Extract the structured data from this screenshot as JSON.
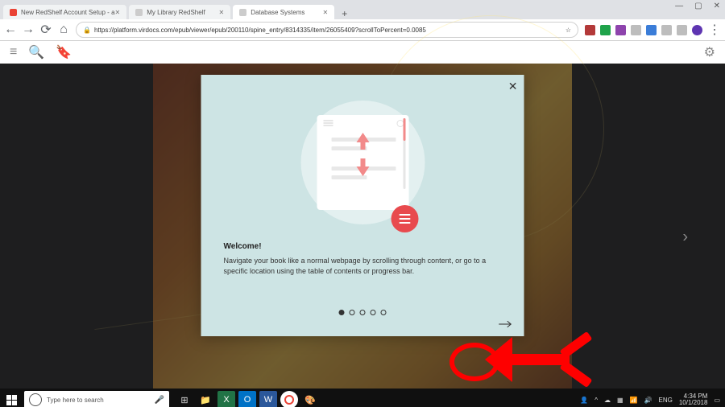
{
  "browser": {
    "tabs": [
      {
        "label": "New RedShelf Account Setup - a",
        "active": false,
        "favicon": "#ea4335"
      },
      {
        "label": "My Library RedShelf",
        "active": false,
        "favicon": "#888"
      },
      {
        "label": "Database Systems",
        "active": true,
        "favicon": "#888"
      }
    ],
    "url": "https://platform.virdocs.com/epub/viewer/epub/200110/spine_entry/8314335/item/26055409?scrollToPercent=0.0085",
    "window_controls": {
      "min": "—",
      "max": "▢",
      "close": "✕"
    },
    "nav": {
      "back": "←",
      "fwd": "→",
      "reload": "⟳",
      "home": "⌂",
      "lock": "🔒",
      "star": "☆",
      "menu": "⋮"
    },
    "extensions": [
      {
        "color": "#b33939"
      },
      {
        "color": "#1fa34a"
      },
      {
        "color": "#8e44ad"
      },
      {
        "color": "#bdbdbd"
      },
      {
        "color": "#3b7dd8"
      },
      {
        "color": "#bdbdbd"
      },
      {
        "color": "#bdbdbd"
      },
      {
        "color": "#5e35b1"
      }
    ]
  },
  "modal": {
    "title": "Welcome!",
    "body": "Navigate your book like a normal webpage by scrolling through content, or go to a specific location using the table of contents or progress bar.",
    "dots_total": 5,
    "dot_active": 0
  },
  "taskbar": {
    "search_placeholder": "Type here to search",
    "apps": [
      {
        "bg": "#1f1f1f",
        "glyph": "⊞",
        "color": "#fff"
      },
      {
        "bg": "#d09b2a",
        "glyph": "📁"
      },
      {
        "bg": "#217346",
        "glyph": "X",
        "color": "#fff"
      },
      {
        "bg": "#2b579a",
        "glyph": "O",
        "color": "#fff"
      },
      {
        "bg": "#2b579a",
        "glyph": "W",
        "color": "#fff"
      },
      {
        "bg": "#fff",
        "glyph": "◉",
        "color": "#ea4335"
      },
      {
        "bg": "#1f1f1f",
        "glyph": "🎨"
      }
    ],
    "tray": {
      "people": "👤",
      "up": "^",
      "cloud": "☁",
      "net": "▦",
      "wifi": "📶",
      "vol": "🔊",
      "lang": "ENG",
      "time": "4:34 PM",
      "date": "10/1/2018",
      "action": "▭"
    }
  }
}
